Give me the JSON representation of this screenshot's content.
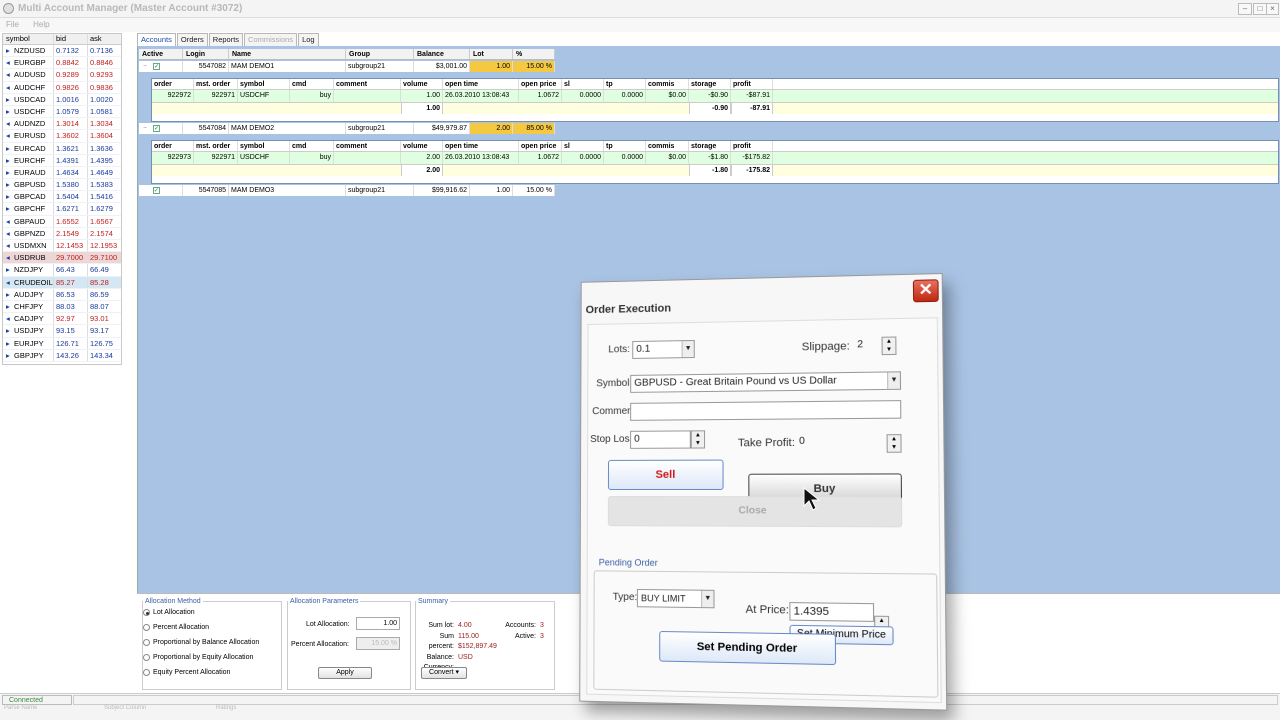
{
  "window": {
    "title": "Multi Account Manager (Master Account #3072)",
    "min": "–",
    "max": "□",
    "close": "×"
  },
  "menu": [
    "File",
    "Help"
  ],
  "quotes": {
    "headers": {
      "symbol": "symbol",
      "bid": "bid",
      "ask": "ask"
    },
    "rows": [
      {
        "symbol": "NZDUSD",
        "bid": "0.7132",
        "ask": "0.7136",
        "dir": "up"
      },
      {
        "symbol": "EURGBP",
        "bid": "0.8842",
        "ask": "0.8846",
        "dir": "dn"
      },
      {
        "symbol": "AUDUSD",
        "bid": "0.9289",
        "ask": "0.9293",
        "dir": "dn"
      },
      {
        "symbol": "AUDCHF",
        "bid": "0.9826",
        "ask": "0.9836",
        "dir": "dn"
      },
      {
        "symbol": "USDCAD",
        "bid": "1.0016",
        "ask": "1.0020",
        "dir": "up"
      },
      {
        "symbol": "USDCHF",
        "bid": "1.0579",
        "ask": "1.0581",
        "dir": "up"
      },
      {
        "symbol": "AUDNZD",
        "bid": "1.3014",
        "ask": "1.3034",
        "dir": "dn"
      },
      {
        "symbol": "EURUSD",
        "bid": "1.3602",
        "ask": "1.3604",
        "dir": "dn"
      },
      {
        "symbol": "EURCAD",
        "bid": "1.3621",
        "ask": "1.3636",
        "dir": "up"
      },
      {
        "symbol": "EURCHF",
        "bid": "1.4391",
        "ask": "1.4395",
        "dir": "up"
      },
      {
        "symbol": "EURAUD",
        "bid": "1.4634",
        "ask": "1.4649",
        "dir": "up"
      },
      {
        "symbol": "GBPUSD",
        "bid": "1.5380",
        "ask": "1.5383",
        "dir": "up"
      },
      {
        "symbol": "GBPCAD",
        "bid": "1.5404",
        "ask": "1.5416",
        "dir": "up"
      },
      {
        "symbol": "GBPCHF",
        "bid": "1.6271",
        "ask": "1.6279",
        "dir": "up"
      },
      {
        "symbol": "GBPAUD",
        "bid": "1.6552",
        "ask": "1.6567",
        "dir": "dn"
      },
      {
        "symbol": "GBPNZD",
        "bid": "2.1549",
        "ask": "2.1574",
        "dir": "dn"
      },
      {
        "symbol": "USDMXN",
        "bid": "12.1453",
        "ask": "12.1953",
        "dir": "dn"
      },
      {
        "symbol": "USDRUB",
        "bid": "29.7000",
        "ask": "29.7100",
        "dir": "dn",
        "sel": "sel2"
      },
      {
        "symbol": "NZDJPY",
        "bid": "66.43",
        "ask": "66.49",
        "dir": "up"
      },
      {
        "symbol": "CRUDEOIL",
        "bid": "85.27",
        "ask": "85.28",
        "dir": "dn",
        "sel": "sel"
      },
      {
        "symbol": "AUDJPY",
        "bid": "86.53",
        "ask": "86.59",
        "dir": "up"
      },
      {
        "symbol": "CHFJPY",
        "bid": "88.03",
        "ask": "88.07",
        "dir": "up"
      },
      {
        "symbol": "CADJPY",
        "bid": "92.97",
        "ask": "93.01",
        "dir": "dn"
      },
      {
        "symbol": "USDJPY",
        "bid": "93.15",
        "ask": "93.17",
        "dir": "up"
      },
      {
        "symbol": "EURJPY",
        "bid": "126.71",
        "ask": "126.75",
        "dir": "up"
      },
      {
        "symbol": "GBPJPY",
        "bid": "143.26",
        "ask": "143.34",
        "dir": "up"
      }
    ]
  },
  "tabs": [
    "Accounts",
    "Orders",
    "Reports",
    "Commissions",
    "Log"
  ],
  "accounts": {
    "headers": {
      "active": "Active",
      "login": "Login",
      "name": "Name",
      "group": "Group",
      "balance": "Balance",
      "lot": "Lot",
      "pct": "%"
    },
    "rows": [
      {
        "login": "5547082",
        "name": "MAM DEMO1",
        "group": "subgroup21",
        "balance": "$3,001.00",
        "lot": "1.00",
        "pct": "15.00 %",
        "expand": "−",
        "orders": {
          "order": "922972",
          "mst": "922971",
          "symbol": "USDCHF",
          "cmd": "buy",
          "comment": "",
          "volume": "1.00",
          "open_time": "26.03.2010 13:08:43",
          "open_price": "1.0672",
          "sl": "0.0000",
          "tp": "0.0000",
          "commis": "$0.00",
          "storage": "-$0.90",
          "profit": "-$87.91",
          "total_volume": "1.00",
          "total_storage": "-0.90",
          "total_profit": "-87.91"
        }
      },
      {
        "login": "5547084",
        "name": "MAM DEMO2",
        "group": "subgroup21",
        "balance": "$49,979.87",
        "lot": "2.00",
        "pct": "85.00 %",
        "expand": "−",
        "orders": {
          "order": "922973",
          "mst": "922971",
          "symbol": "USDCHF",
          "cmd": "buy",
          "comment": "",
          "volume": "2.00",
          "open_time": "26.03.2010 13:08:43",
          "open_price": "1.0672",
          "sl": "0.0000",
          "tp": "0.0000",
          "commis": "$0.00",
          "storage": "-$1.80",
          "profit": "-$175.82",
          "total_volume": "2.00",
          "total_storage": "-1.80",
          "total_profit": "-175.82"
        }
      },
      {
        "login": "5547085",
        "name": "MAM DEMO3",
        "group": "subgroup21",
        "balance": "$99,916.62",
        "lot": "1.00",
        "pct": "15.00 %",
        "expand": ""
      }
    ],
    "order_headers": {
      "order": "order",
      "mst": "mst. order",
      "symbol": "symbol",
      "cmd": "cmd",
      "comment": "comment",
      "volume": "volume",
      "open_time": "open time",
      "open_price": "open price",
      "sl": "sl",
      "tp": "tp",
      "commis": "commis",
      "storage": "storage",
      "profit": "profit"
    }
  },
  "allocation": {
    "legend": "Allocation Method",
    "options": [
      "Lot Allocation",
      "Percent Allocation",
      "Proportional by Balance Allocation",
      "Proportional by Equity Allocation",
      "Equity Percent Allocation"
    ],
    "selected": 0
  },
  "params": {
    "legend": "Allocation Parameters",
    "lot_label": "Lot Allocation:",
    "lot_value": "1.00",
    "pct_label": "Percent Allocation:",
    "pct_value": "15.00 %",
    "apply": "Apply"
  },
  "summary": {
    "legend": "Summary",
    "sum_lot_label": "Sum lot:",
    "sum_lot": "4.00",
    "sum_pct_label": "Sum percent:",
    "sum_pct": "115.00",
    "balance_label": "Balance:",
    "balance": "$152,897.49",
    "currency_label": "Currency:",
    "currency": "USD",
    "accounts_label": "Accounts:",
    "accounts": "3",
    "active_label": "Active:",
    "active": "3",
    "convert": "Convert ▾"
  },
  "status": {
    "connected": "Connected",
    "ghost": [
      "Parse Name",
      "Subject Column",
      "Ratings"
    ]
  },
  "dialog": {
    "title": "Order Execution",
    "close": "✕",
    "lots_label": "Lots:",
    "lots": "0.1",
    "slippage_label": "Slippage:",
    "slippage": "2",
    "symbol_label": "Symbol:",
    "symbol": "GBPUSD - Great Britain Pound vs US Dollar",
    "comment_label": "Comment:",
    "comment": "",
    "sl_label": "Stop Loss:",
    "sl": "0",
    "tp_label": "Take Profit:",
    "tp": "0",
    "sell": "Sell",
    "buy": "Buy",
    "close_btn": "Close",
    "pending_label": "Pending Order",
    "type_label": "Type:",
    "type": "BUY LIMIT",
    "price_label": "At Price:",
    "price": "1.4395",
    "set_min": "Set Minimum Price",
    "set_pending": "Set Pending Order"
  },
  "colors": {
    "accent": "#1a48a8",
    "panel": "#a9c3e4",
    "highlight": "#f5c842",
    "sell": "#c02020"
  }
}
